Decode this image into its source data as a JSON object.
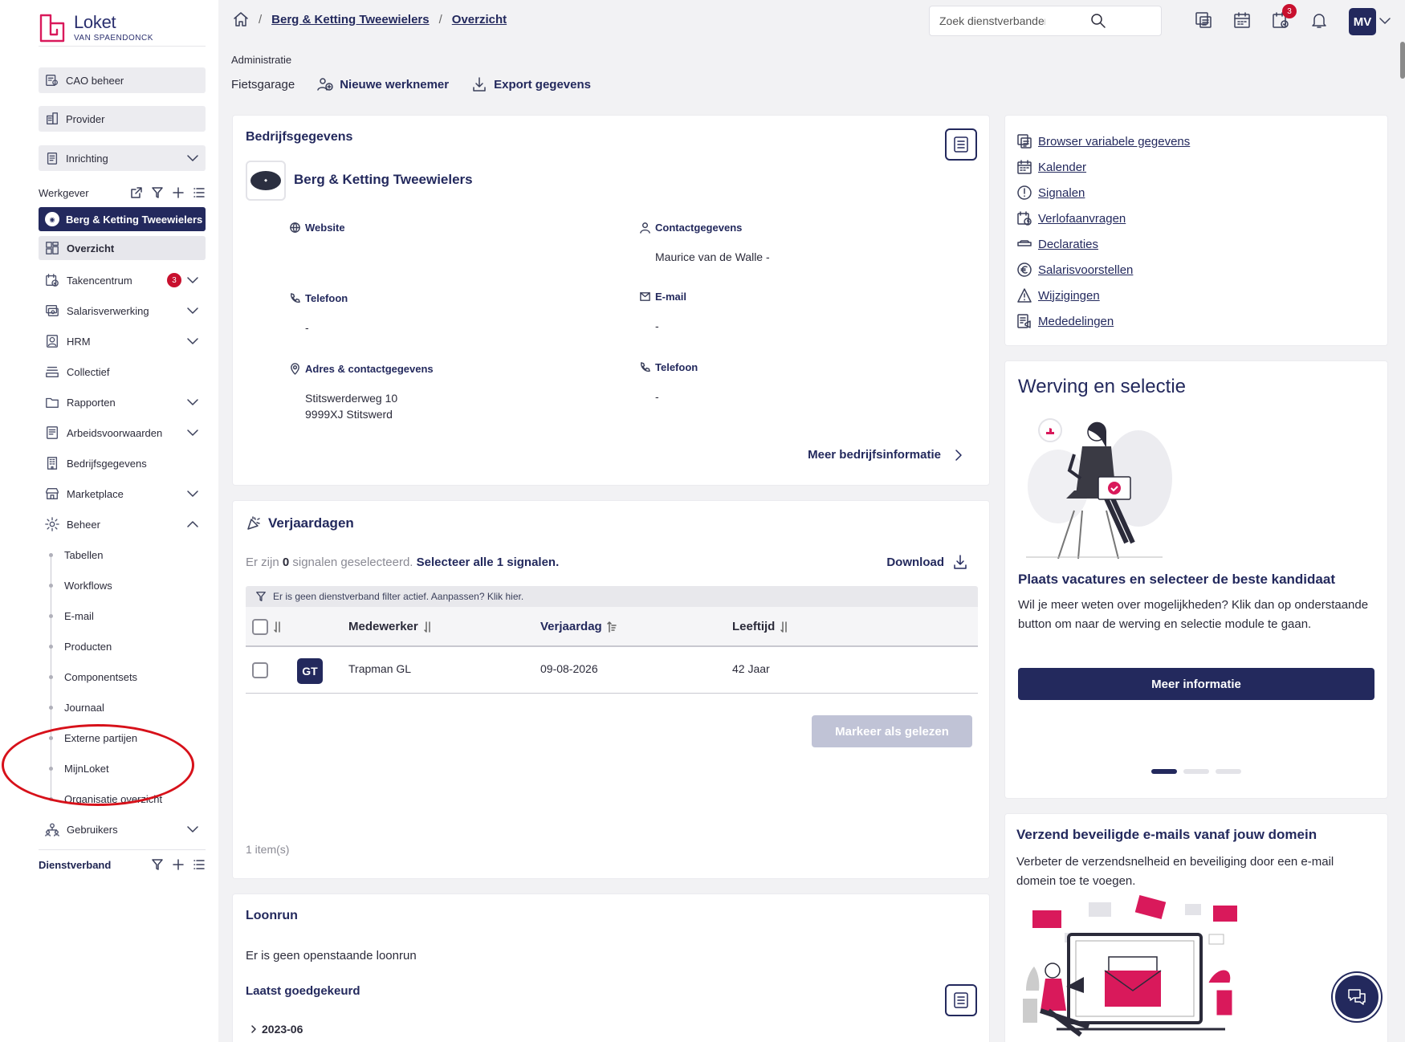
{
  "brand": {
    "name": "Loket",
    "sub": "VAN SPAENDONCK",
    "accent": "#d9195b",
    "navy": "#23295d"
  },
  "sidebar": {
    "cao": "CAO beheer",
    "provider": "Provider",
    "inrichting": "Inrichting",
    "werkgever_label": "Werkgever",
    "active_employer": "Berg & Ketting Tweewielers",
    "items": [
      {
        "label": "Overzicht",
        "icon": "grid-icon"
      },
      {
        "label": "Takencentrum",
        "icon": "tasks-icon",
        "badge": "3"
      },
      {
        "label": "Salarisverwerking",
        "icon": "payroll-icon"
      },
      {
        "label": "HRM",
        "icon": "person-icon"
      },
      {
        "label": "Collectief",
        "icon": "stack-icon"
      },
      {
        "label": "Rapporten",
        "icon": "folder-icon"
      },
      {
        "label": "Arbeidsvoorwaarden",
        "icon": "document-icon"
      },
      {
        "label": "Bedrijfsgegevens",
        "icon": "building-icon"
      },
      {
        "label": "Marketplace",
        "icon": "store-icon"
      },
      {
        "label": "Beheer",
        "icon": "gear-icon"
      }
    ],
    "beheer_sub": [
      "Tabellen",
      "Workflows",
      "E-mail",
      "Producten",
      "Componentsets",
      "Journaal",
      "Externe partijen",
      "MijnLoket",
      "Organisatie overzicht"
    ],
    "gebruikers": "Gebruikers",
    "dienstverband_label": "Dienstverband"
  },
  "topbar": {
    "breadcrumb": [
      "Berg & Ketting Tweewielers",
      "Overzicht"
    ],
    "search_placeholder": "Zoek dienstverbanden, werkgevers...",
    "tasks_badge": "3",
    "user_initials": "MV"
  },
  "page": {
    "label": "Administratie",
    "plain": "Fietsgarage",
    "new_employee": "Nieuwe werknemer",
    "export": "Export gegevens"
  },
  "company": {
    "title": "Bedrijfsgegevens",
    "name": "Berg & Ketting Tweewielers",
    "website_label": "Website",
    "contact_label": "Contactgegevens",
    "contact_value": "Maurice van de Walle -",
    "phone_label": "Telefoon",
    "phone_value": "-",
    "email_label": "E-mail",
    "email_value": "-",
    "address_label": "Adres & contactgegevens",
    "address_line1": "Stitswerderweg 10",
    "address_line2": "9999XJ Stitswerd",
    "phone2_label": "Telefoon",
    "phone2_value": "-",
    "more": "Meer bedrijfsinformatie"
  },
  "links": [
    {
      "label": "Browser variabele gegevens",
      "icon": "browser-icon"
    },
    {
      "label": "Kalender",
      "icon": "calendar-icon"
    },
    {
      "label": "Signalen",
      "icon": "alert-circle-icon"
    },
    {
      "label": "Verlofaanvragen",
      "icon": "leave-icon"
    },
    {
      "label": "Declaraties",
      "icon": "receipt-icon"
    },
    {
      "label": "Salarisvoorstellen",
      "icon": "euro-icon"
    },
    {
      "label": "Wijzigingen",
      "icon": "warning-icon"
    },
    {
      "label": "Mededelingen",
      "icon": "announcement-icon"
    }
  ],
  "birthdays": {
    "title": "Verjaardagen",
    "sel_pre": "Er zijn",
    "sel_count": "0",
    "sel_post": "signalen geselecteerd.",
    "sel_all": "Selecteer alle 1 signalen.",
    "download": "Download",
    "filter_text": "Er is geen dienstverband filter actief. Aanpassen? Klik hier.",
    "columns": [
      "Medewerker",
      "Verjaardag",
      "Leeftijd"
    ],
    "rows": [
      {
        "initials": "GT",
        "name": "Trapman GL",
        "date": "09-08-2026",
        "age": "42 Jaar"
      }
    ],
    "mark_read": "Markeer als gelezen",
    "count": "1 item(s)"
  },
  "loonrun": {
    "title": "Loonrun",
    "text": "Er is geen openstaande loonrun",
    "sub": "Laatst goedgekeurd",
    "period": "2023-06"
  },
  "werving": {
    "title": "Werving en selectie",
    "sub": "Plaats vacatures en selecteer de beste kandidaat",
    "text": "Wil je meer weten over mogelijkheden? Klik dan op onderstaande button om naar de werving en selectie module te gaan.",
    "button": "Meer informatie"
  },
  "email_card": {
    "title": "Verzend beveiligde e-mails vanaf jouw domein",
    "text": "Verbeter de verzendsnelheid en beveiliging door een e-mail domein toe te voegen."
  }
}
